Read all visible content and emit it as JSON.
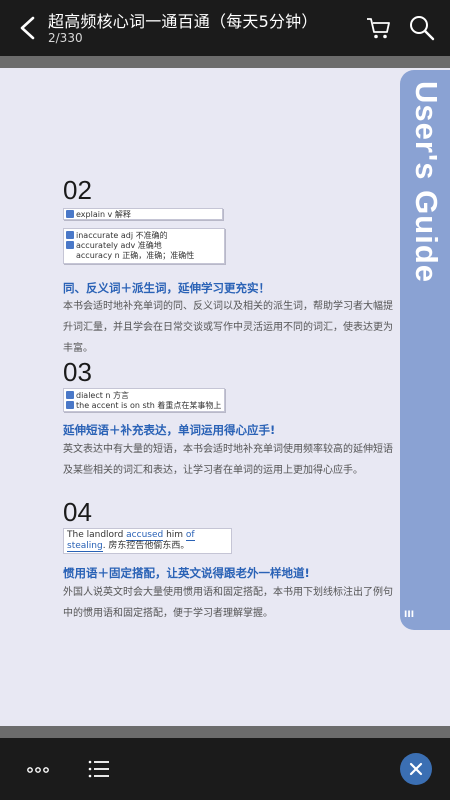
{
  "header": {
    "title": "超高频核心词一通百通（每天5分钟）",
    "page_indicator": "2/330"
  },
  "guide_tab": {
    "label": "User's Guide",
    "roman": "III"
  },
  "section2": {
    "number": "02",
    "box1_row1": "explain v 解释",
    "box2_row1": "inaccurate adj 不准确的",
    "box2_row2": "accurately adv 准确地",
    "box2_row3": "accuracy n 正确，准确；准确性",
    "heading": "同、反义词＋派生词，延伸学习更充实！",
    "body": "本书会适时地补充单词的同、反义词以及相关的派生词，帮助学习者大幅提升词汇量，并且学会在日常交谈或写作中灵活运用不同的词汇，使表达更为丰富。"
  },
  "section3": {
    "number": "03",
    "box_row1": "dialect n 方言",
    "box_row2": "the accent is on sth 着重点在某事物上",
    "heading": "延伸短语＋补充表达，单词运用得心应手!",
    "body": "英文表达中有大量的短语，本书会适时地补充单词使用频率较高的延伸短语及某些相关的词汇和表达，让学习者在单词的运用上更加得心应手。"
  },
  "section4": {
    "number": "04",
    "sent_pre": "The landlord ",
    "sent_u1": "accused",
    "sent_mid": " him ",
    "sent_u2": "of",
    "sent_line2_u": "stealing",
    "sent_line2_rest": ". 房东控告他偷东西。",
    "heading": "惯用语＋固定搭配，让英文说得跟老外一样地道!",
    "body": "外国人说英文时会大量使用惯用语和固定搭配，本书用下划线标注出了例句中的惯用语和固定搭配，便于学习者理解掌握。"
  },
  "icons": [
    "back-chevron-icon",
    "cart-icon",
    "search-icon",
    "more-dots-icon",
    "list-menu-icon",
    "close-icon"
  ],
  "colors": {
    "accent": "#2a62b6",
    "tab": "#8aa2d3",
    "bar": "#1b1b1b",
    "close": "#3b6fb3"
  }
}
